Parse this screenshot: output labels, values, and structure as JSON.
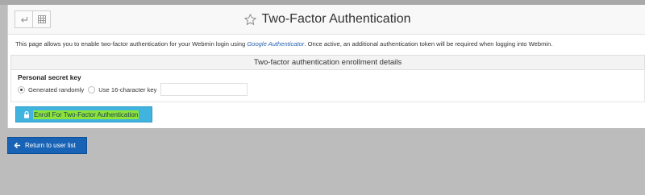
{
  "header": {
    "title": "Two-Factor Authentication",
    "back_icon": "undo-arrow-icon",
    "grid_icon": "grid-icon",
    "favorite_icon": "star-icon"
  },
  "intro": {
    "text_before": "This page allows you to enable two-factor authentication for your Webmin login using ",
    "link_text": "Google Authenticator",
    "text_after": ". Once active, an additional authentication token will be required when logging into Webmin."
  },
  "section": {
    "title": "Two-factor authentication enrollment details",
    "field_label": "Personal secret key",
    "options": [
      {
        "label": "Generated randomly",
        "selected": true
      },
      {
        "label": "Use 16-character key",
        "selected": false
      }
    ],
    "key_value": ""
  },
  "enroll_button": {
    "label": "Enroll For Two-Factor Authentication",
    "icon": "lock-icon",
    "color": "#40b4df",
    "highlight": "#8de33a"
  },
  "back_button": {
    "label": "Return to user list",
    "icon": "arrow-left-icon",
    "color": "#1863b6"
  }
}
